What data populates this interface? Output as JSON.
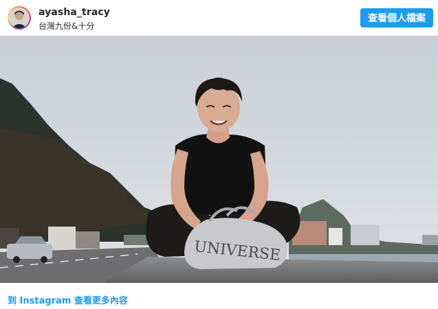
{
  "header": {
    "username": "ayasha_tracy",
    "location": "台灣九份&十分",
    "profile_button_label": "查看個人檔案"
  },
  "photo": {
    "bag_text": "UNIVERSE"
  },
  "footer": {
    "link_label": "到 Instagram 查看更多內容"
  },
  "colors": {
    "accent": "#1a9cf0",
    "text": "#262626"
  }
}
